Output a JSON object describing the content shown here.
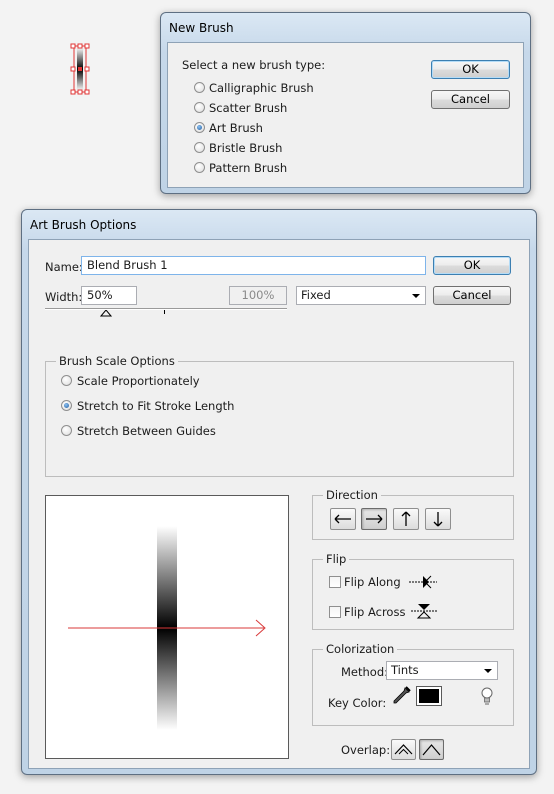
{
  "new_brush": {
    "title": "New Brush",
    "prompt": "Select a new brush type:",
    "options": [
      {
        "label": "Calligraphic Brush",
        "selected": false
      },
      {
        "label": "Scatter Brush",
        "selected": false
      },
      {
        "label": "Art Brush",
        "selected": true
      },
      {
        "label": "Bristle Brush",
        "selected": false
      },
      {
        "label": "Pattern Brush",
        "selected": false
      }
    ],
    "ok_label": "OK",
    "cancel_label": "Cancel"
  },
  "art_brush": {
    "title": "Art Brush Options",
    "name_label": "Name:",
    "name_value": "Blend Brush 1",
    "ok_label": "OK",
    "cancel_label": "Cancel",
    "width_label": "Width:",
    "width_value": "50%",
    "width_max": "100%",
    "width_mode": "Fixed",
    "scale_group": {
      "title": "Brush Scale Options",
      "options": [
        {
          "label": "Scale Proportionately",
          "selected": false
        },
        {
          "label": "Stretch to Fit Stroke Length",
          "selected": true
        },
        {
          "label": "Stretch Between Guides",
          "selected": false
        }
      ]
    },
    "direction": {
      "title": "Direction",
      "selected": "right"
    },
    "flip": {
      "title": "Flip",
      "along_label": "Flip Along",
      "along_checked": false,
      "across_label": "Flip Across",
      "across_checked": false
    },
    "colorization": {
      "title": "Colorization",
      "method_label": "Method:",
      "method_value": "Tints",
      "key_color_label": "Key Color:",
      "key_color": "#000000"
    },
    "overlap_label": "Overlap:",
    "preview_arrow_color": "#d9393a"
  }
}
